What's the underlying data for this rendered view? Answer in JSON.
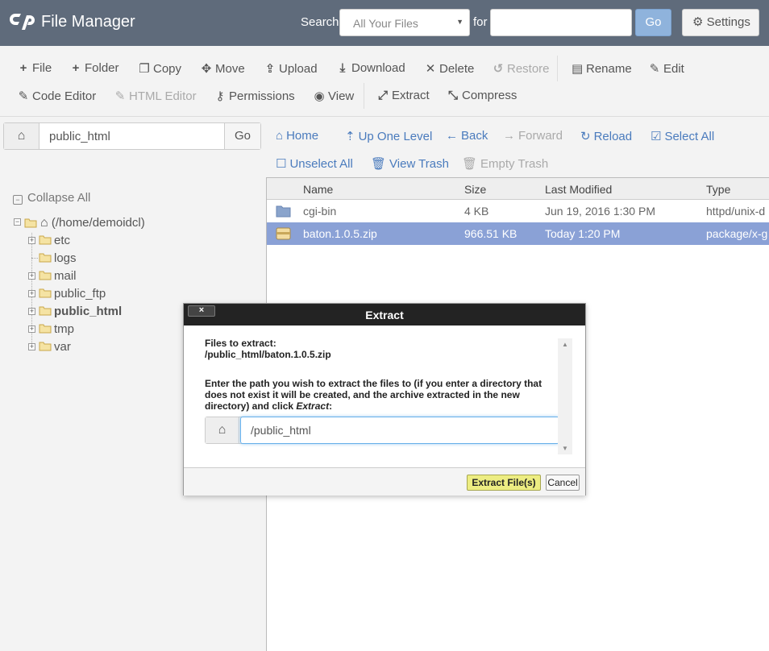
{
  "header": {
    "title": "File Manager",
    "search_label": "Search",
    "search_select": "All Your Files",
    "for_label": "for",
    "search_value": "",
    "go_label": "Go",
    "settings_label": "Settings",
    "bg_color": "#5f6b7b"
  },
  "toolbar": {
    "row1": [
      {
        "label": "File",
        "icon": "plus-icon",
        "disabled": false
      },
      {
        "label": "Folder",
        "icon": "plus-icon",
        "disabled": false
      },
      {
        "label": "Copy",
        "icon": "copy-icon",
        "disabled": false
      },
      {
        "label": "Move",
        "icon": "move-icon",
        "disabled": false
      },
      {
        "label": "Upload",
        "icon": "upload-icon",
        "disabled": false
      },
      {
        "label": "Download",
        "icon": "download-icon",
        "disabled": false
      },
      {
        "label": "Delete",
        "icon": "x-icon",
        "disabled": false
      },
      {
        "label": "Restore",
        "icon": "restore-icon",
        "disabled": true
      },
      {
        "label": "Rename",
        "icon": "file-icon",
        "disabled": false
      },
      {
        "label": "Edit",
        "icon": "pencil-icon",
        "disabled": false
      }
    ],
    "row2": [
      {
        "label": "Code Editor",
        "icon": "code-editor-icon",
        "disabled": false
      },
      {
        "label": "HTML Editor",
        "icon": "html-editor-icon",
        "disabled": true
      },
      {
        "label": "Permissions",
        "icon": "key-icon",
        "disabled": false
      },
      {
        "label": "View",
        "icon": "eye-icon",
        "disabled": false
      },
      {
        "label": "Extract",
        "icon": "extract-icon",
        "disabled": false
      },
      {
        "label": "Compress",
        "icon": "compress-icon",
        "disabled": false
      }
    ]
  },
  "pathbar": {
    "value": "public_html",
    "go_label": "Go"
  },
  "nav": {
    "row1": [
      {
        "label": "Home",
        "icon": "home-icon",
        "disabled": false
      },
      {
        "label": "Up One Level",
        "icon": "level-up-icon",
        "disabled": false
      },
      {
        "label": "Back",
        "icon": "arrow-left-icon",
        "disabled": false
      },
      {
        "label": "Forward",
        "icon": "arrow-right-icon",
        "disabled": true
      },
      {
        "label": "Reload",
        "icon": "reload-icon",
        "disabled": false
      },
      {
        "label": "Select All",
        "icon": "check-square-icon",
        "disabled": false
      }
    ],
    "row2": [
      {
        "label": "Unselect All",
        "icon": "square-icon",
        "disabled": false
      },
      {
        "label": "View Trash",
        "icon": "trash-icon",
        "disabled": false
      },
      {
        "label": "Empty Trash",
        "icon": "trash-icon",
        "disabled": true
      }
    ]
  },
  "tree": {
    "collapse_label": "Collapse All",
    "root_label": "(/home/demoidcl)",
    "items": [
      {
        "label": "etc",
        "expandable": true,
        "bold": false
      },
      {
        "label": "logs",
        "expandable": false,
        "bold": false
      },
      {
        "label": "mail",
        "expandable": true,
        "bold": false
      },
      {
        "label": "public_ftp",
        "expandable": true,
        "bold": false
      },
      {
        "label": "public_html",
        "expandable": true,
        "bold": true
      },
      {
        "label": "tmp",
        "expandable": true,
        "bold": false
      },
      {
        "label": "var",
        "expandable": true,
        "bold": false
      }
    ]
  },
  "files": {
    "columns": [
      "Name",
      "Size",
      "Last Modified",
      "Type"
    ],
    "rows": [
      {
        "name": "cgi-bin",
        "size": "4 KB",
        "modified": "Jun 19, 2016 1:30 PM",
        "type": "httpd/unix-d",
        "icon": "folder-icon",
        "selected": false
      },
      {
        "name": "baton.1.0.5.zip",
        "size": "966.51 KB",
        "modified": "Today 1:20 PM",
        "type": "package/x-g",
        "icon": "archive-icon",
        "selected": true
      }
    ],
    "selected_color": "#8aa1d6"
  },
  "dialog": {
    "title": "Extract",
    "close_label": "×",
    "files_label": "Files to extract:",
    "file_path": "/public_html/baton.1.0.5.zip",
    "instructions_1": "Enter the path you wish to extract the files to (if you enter a directory that",
    "instructions_2": "does not exist it will be created, and the archive extracted in the new",
    "instructions_3": "directory) and click ",
    "instructions_em": "Extract",
    "instructions_end": ":",
    "path_value": "/public_html",
    "extract_label": "Extract File(s)",
    "cancel_label": "Cancel"
  }
}
